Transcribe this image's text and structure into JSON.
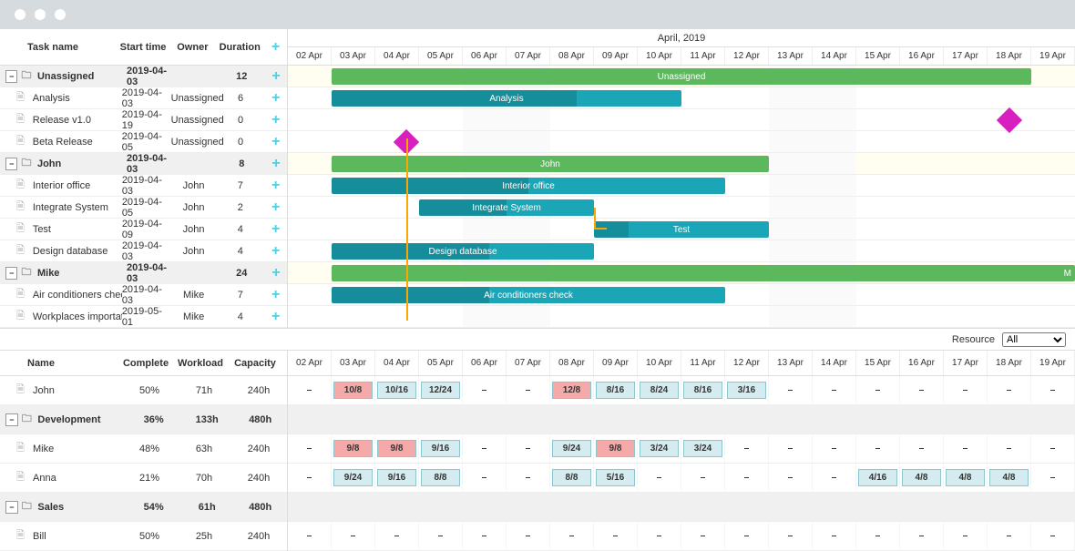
{
  "month_label": "April, 2019",
  "days": [
    "02 Apr",
    "03 Apr",
    "04 Apr",
    "05 Apr",
    "06 Apr",
    "07 Apr",
    "08 Apr",
    "09 Apr",
    "10 Apr",
    "11 Apr",
    "12 Apr",
    "13 Apr",
    "14 Apr",
    "15 Apr",
    "16 Apr",
    "17 Apr",
    "18 Apr",
    "19 Apr"
  ],
  "weekends": [
    4,
    5,
    11,
    12
  ],
  "task_cols": {
    "name": "Task name",
    "start": "Start time",
    "owner": "Owner",
    "dur": "Duration"
  },
  "tasks": [
    {
      "type": "group",
      "name": "Unassigned",
      "start": "2019-04-03",
      "owner": "",
      "dur": "12",
      "bar_start": 1,
      "bar_len": 16,
      "color": "green",
      "label": "Unassigned"
    },
    {
      "type": "task",
      "name": "Analysis",
      "start": "2019-04-03",
      "owner": "Unassigned",
      "dur": "6",
      "bar_start": 1,
      "bar_len": 8,
      "color": "teal",
      "label": "Analysis",
      "progress": 0.7
    },
    {
      "type": "task",
      "name": "Release v1.0",
      "start": "2019-04-19",
      "owner": "Unassigned",
      "dur": "0",
      "milestone": true,
      "ms_pos": 16.5
    },
    {
      "type": "task",
      "name": "Beta Release",
      "start": "2019-04-05",
      "owner": "Unassigned",
      "dur": "0",
      "milestone": true,
      "ms_pos": 2.7
    },
    {
      "type": "group",
      "name": "John",
      "start": "2019-04-03",
      "owner": "",
      "dur": "8",
      "bar_start": 1,
      "bar_len": 10,
      "color": "green",
      "label": "John"
    },
    {
      "type": "task",
      "name": "Interior office",
      "start": "2019-04-03",
      "owner": "John",
      "dur": "7",
      "bar_start": 1,
      "bar_len": 9,
      "color": "teal",
      "label": "Interior office",
      "progress": 0.5
    },
    {
      "type": "task",
      "name": "Integrate System",
      "start": "2019-04-05",
      "owner": "John",
      "dur": "2",
      "bar_start": 3,
      "bar_len": 4,
      "color": "teal",
      "label": "Integrate System",
      "progress": 0.5
    },
    {
      "type": "task",
      "name": "Test",
      "start": "2019-04-09",
      "owner": "John",
      "dur": "4",
      "bar_start": 7,
      "bar_len": 4,
      "color": "teal",
      "label": "Test",
      "progress": 0.2
    },
    {
      "type": "task",
      "name": "Design database",
      "start": "2019-04-03",
      "owner": "John",
      "dur": "4",
      "bar_start": 1,
      "bar_len": 6,
      "color": "teal",
      "label": "Design database",
      "progress": 0.6
    },
    {
      "type": "group",
      "name": "Mike",
      "start": "2019-04-03",
      "owner": "",
      "dur": "24",
      "bar_start": 1,
      "bar_len": 17,
      "color": "green",
      "label": "M",
      "overflow": true
    },
    {
      "type": "task",
      "name": "Air conditioners check",
      "start": "2019-04-03",
      "owner": "Mike",
      "dur": "7",
      "bar_start": 1,
      "bar_len": 9,
      "color": "teal",
      "label": "Air conditioners check",
      "progress": 0.4
    },
    {
      "type": "task",
      "name": "Workplaces importation",
      "start": "2019-05-01",
      "owner": "Mike",
      "dur": "4"
    }
  ],
  "res_filter": {
    "label": "Resource",
    "selected": "All",
    "options": [
      "All"
    ]
  },
  "res_cols": {
    "name": "Name",
    "comp": "Complete",
    "work": "Workload",
    "cap": "Capacity"
  },
  "resources": [
    {
      "type": "item",
      "name": "John",
      "comp": "50%",
      "work": "71h",
      "cap": "240h",
      "cells": [
        "–",
        "10/8:over",
        "10/16:norm",
        "12/24:norm",
        "–",
        "–",
        "12/8:over",
        "8/16:norm",
        "8/24:norm",
        "8/16:norm",
        "3/16:norm",
        "–",
        "–",
        "–",
        "–",
        "–",
        "–",
        "–"
      ]
    },
    {
      "type": "group",
      "name": "Development",
      "comp": "36%",
      "work": "133h",
      "cap": "480h"
    },
    {
      "type": "item",
      "name": "Mike",
      "comp": "48%",
      "work": "63h",
      "cap": "240h",
      "cells": [
        "–",
        "9/8:over",
        "9/8:over",
        "9/16:norm",
        "–",
        "–",
        "9/24:norm",
        "9/8:over",
        "3/24:norm",
        "3/24:norm",
        "–",
        "–",
        "–",
        "–",
        "–",
        "–",
        "–",
        "–"
      ]
    },
    {
      "type": "item",
      "name": "Anna",
      "comp": "21%",
      "work": "70h",
      "cap": "240h",
      "cells": [
        "–",
        "9/24:norm",
        "9/16:norm",
        "8/8:norm",
        "–",
        "–",
        "8/8:norm",
        "5/16:norm",
        "–",
        "–",
        "–",
        "–",
        "–",
        "4/16:norm",
        "4/8:norm",
        "4/8:norm",
        "4/8:norm",
        "–"
      ]
    },
    {
      "type": "group",
      "name": "Sales",
      "comp": "54%",
      "work": "61h",
      "cap": "480h"
    },
    {
      "type": "item",
      "name": "Bill",
      "comp": "50%",
      "work": "25h",
      "cap": "240h",
      "cells": [
        "–",
        "–",
        "–",
        "–",
        "–",
        "–",
        "–",
        "–",
        "–",
        "–",
        "–",
        "–",
        "–",
        "–",
        "–",
        "–",
        "–",
        "–"
      ]
    }
  ]
}
